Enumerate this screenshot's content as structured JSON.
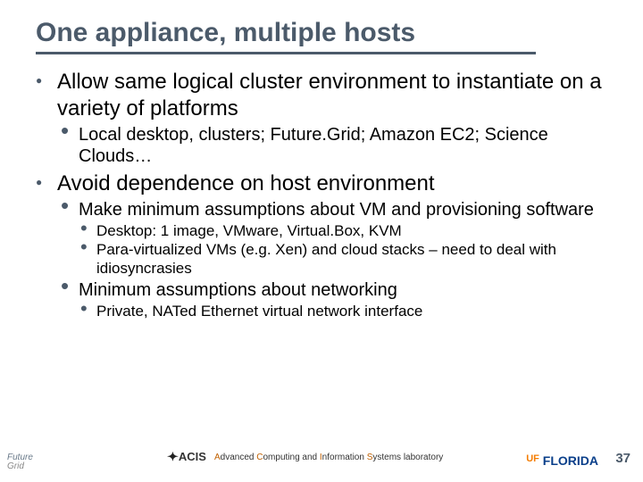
{
  "title": "One appliance, multiple hosts",
  "bullets": [
    {
      "text": "Allow same logical cluster environment to instantiate on a variety of platforms",
      "children": [
        {
          "text": "Local desktop, clusters; Future.Grid; Amazon EC2; Science Clouds…"
        }
      ]
    },
    {
      "text": "Avoid dependence on host environment",
      "children": [
        {
          "text": "Make minimum assumptions about VM and provisioning software",
          "children": [
            {
              "text": "Desktop: 1 image, VMware, Virtual.Box, KVM"
            },
            {
              "text": "Para-virtualized VMs (e.g. Xen) and cloud stacks – need to deal with idiosyncrasies"
            }
          ]
        },
        {
          "text": "Minimum assumptions about networking",
          "children": [
            {
              "text": "Private, NATed Ethernet virtual network interface"
            }
          ]
        }
      ]
    }
  ],
  "footer": {
    "fg_logo_top": "Future",
    "fg_logo_bottom": "Grid",
    "acis": "ACIS",
    "lab_text_pre": "A",
    "lab_text_mid1": "dvanced ",
    "lab_text_c": "C",
    "lab_text_mid2": "omputing and ",
    "lab_text_i": "I",
    "lab_text_mid3": "nformation ",
    "lab_text_s": "S",
    "lab_text_end": "ystems laboratory",
    "uf_prefix": "UF",
    "uf_name": "FLORIDA",
    "page": "37"
  }
}
